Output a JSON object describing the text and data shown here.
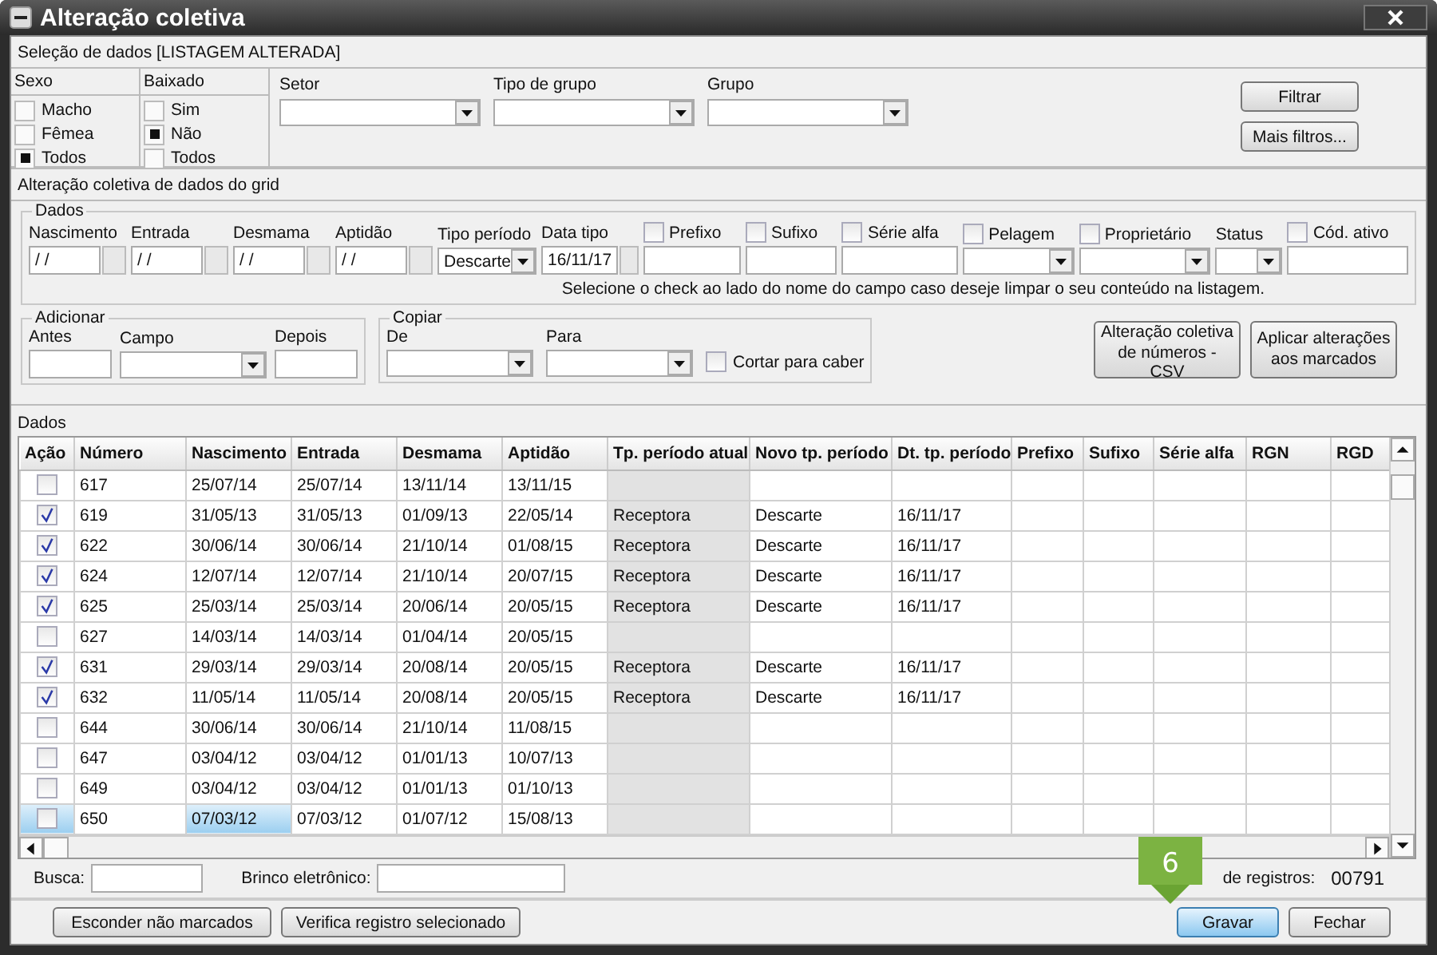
{
  "window": {
    "title": "Alteração coletiva"
  },
  "selection": {
    "title": "Seleção de dados [LISTAGEM ALTERADA]",
    "groups": [
      {
        "label": "Sexo",
        "options": [
          {
            "label": "Macho",
            "selected": false
          },
          {
            "label": "Fêmea",
            "selected": false
          },
          {
            "label": "Todos",
            "selected": true
          }
        ]
      },
      {
        "label": "Baixado",
        "options": [
          {
            "label": "Sim",
            "selected": false
          },
          {
            "label": "Não",
            "selected": true
          },
          {
            "label": "Todos",
            "selected": false
          }
        ]
      }
    ],
    "dropdowns": [
      {
        "label": "Setor"
      },
      {
        "label": "Tipo de grupo"
      },
      {
        "label": "Grupo"
      }
    ],
    "buttons": [
      "Filtrar",
      "Mais filtros..."
    ]
  },
  "bulk_edit": {
    "title": "Alteração coletiva de dados do grid",
    "dados": {
      "legend": "Dados",
      "fields": [
        {
          "kind": "date",
          "label": "Nascimento",
          "value": "/ /"
        },
        {
          "kind": "date",
          "label": "Entrada",
          "value": "/ /"
        },
        {
          "kind": "date",
          "label": "Desmama",
          "value": "/ /"
        },
        {
          "kind": "date",
          "label": "Aptidão",
          "value": "/ /"
        },
        {
          "kind": "select",
          "label": "Tipo período",
          "value": "Descarte"
        },
        {
          "kind": "date",
          "label": "Data tipo",
          "value": "16/11/17"
        },
        {
          "kind": "text",
          "label": "Prefixo",
          "checked": false
        },
        {
          "kind": "text",
          "label": "Sufixo",
          "checked": false
        },
        {
          "kind": "text",
          "label": "Série alfa",
          "checked": false
        },
        {
          "kind": "select",
          "label": "Pelagem",
          "checked": false
        },
        {
          "kind": "select",
          "label": "Proprietário",
          "checked": false
        },
        {
          "kind": "select",
          "label": "Status"
        },
        {
          "kind": "text",
          "label": "Cód. ativo",
          "checked": false
        }
      ],
      "hint": "Selecione o check ao lado do nome do campo caso deseje limpar o seu conteúdo na listagem."
    },
    "adicionar": {
      "legend": "Adicionar",
      "fields": [
        {
          "kind": "text",
          "label": "Antes"
        },
        {
          "kind": "select",
          "label": "Campo"
        },
        {
          "kind": "text",
          "label": "Depois"
        }
      ]
    },
    "copiar": {
      "legend": "Copiar",
      "fields": [
        {
          "kind": "select",
          "label": "De"
        },
        {
          "kind": "select",
          "label": "Para"
        }
      ],
      "option": {
        "label": "Cortar para caber",
        "checked": false
      }
    },
    "buttons": [
      "Alteração coletiva de números - CSV",
      "Aplicar alterações aos marcados"
    ]
  },
  "grid": {
    "title": "Dados",
    "columns": [
      {
        "label": "Ação",
        "shaded": false
      },
      {
        "label": "Número",
        "shaded": false
      },
      {
        "label": "Nascimento",
        "shaded": false
      },
      {
        "label": "Entrada",
        "shaded": false
      },
      {
        "label": "Desmama",
        "shaded": false
      },
      {
        "label": "Aptidão",
        "shaded": false
      },
      {
        "label": "Tp. período atual",
        "shaded": true
      },
      {
        "label": "Novo tp. período",
        "shaded": false
      },
      {
        "label": "Dt. tp. período",
        "shaded": false
      },
      {
        "label": "Prefixo",
        "shaded": false
      },
      {
        "label": "Sufixo",
        "shaded": false
      },
      {
        "label": "Série alfa",
        "shaded": false
      },
      {
        "label": "RGN",
        "shaded": false
      },
      {
        "label": "RGD",
        "shaded": false
      }
    ],
    "rows": [
      {
        "checked": false,
        "selected": false,
        "number": "617",
        "birth": "25/07/14",
        "entry": "25/07/14",
        "weaning": "13/11/14",
        "aptitude": "13/11/15"
      },
      {
        "checked": true,
        "selected": false,
        "number": "619",
        "birth": "31/05/13",
        "entry": "31/05/13",
        "weaning": "01/09/13",
        "aptitude": "22/05/14",
        "current_period": "Receptora",
        "new_period": "Descarte",
        "period_date": "16/11/17"
      },
      {
        "checked": true,
        "selected": false,
        "number": "622",
        "birth": "30/06/14",
        "entry": "30/06/14",
        "weaning": "21/10/14",
        "aptitude": "01/08/15",
        "current_period": "Receptora",
        "new_period": "Descarte",
        "period_date": "16/11/17"
      },
      {
        "checked": true,
        "selected": false,
        "number": "624",
        "birth": "12/07/14",
        "entry": "12/07/14",
        "weaning": "21/10/14",
        "aptitude": "20/07/15",
        "current_period": "Receptora",
        "new_period": "Descarte",
        "period_date": "16/11/17"
      },
      {
        "checked": true,
        "selected": false,
        "number": "625",
        "birth": "25/03/14",
        "entry": "25/03/14",
        "weaning": "20/06/14",
        "aptitude": "20/05/15",
        "current_period": "Receptora",
        "new_period": "Descarte",
        "period_date": "16/11/17"
      },
      {
        "checked": false,
        "selected": false,
        "number": "627",
        "birth": "14/03/14",
        "entry": "14/03/14",
        "weaning": "01/04/14",
        "aptitude": "20/05/15"
      },
      {
        "checked": true,
        "selected": false,
        "number": "631",
        "birth": "29/03/14",
        "entry": "29/03/14",
        "weaning": "20/08/14",
        "aptitude": "20/05/15",
        "current_period": "Receptora",
        "new_period": "Descarte",
        "period_date": "16/11/17"
      },
      {
        "checked": true,
        "selected": false,
        "number": "632",
        "birth": "11/05/14",
        "entry": "11/05/14",
        "weaning": "20/08/14",
        "aptitude": "20/05/15",
        "current_period": "Receptora",
        "new_period": "Descarte",
        "period_date": "16/11/17"
      },
      {
        "checked": false,
        "selected": false,
        "number": "644",
        "birth": "30/06/14",
        "entry": "30/06/14",
        "weaning": "21/10/14",
        "aptitude": "11/08/15"
      },
      {
        "checked": false,
        "selected": false,
        "number": "647",
        "birth": "03/04/12",
        "entry": "03/04/12",
        "weaning": "01/01/13",
        "aptitude": "10/07/13"
      },
      {
        "checked": false,
        "selected": false,
        "number": "649",
        "birth": "03/04/12",
        "entry": "03/04/12",
        "weaning": "01/01/13",
        "aptitude": "01/10/13"
      },
      {
        "checked": false,
        "selected": true,
        "number": "650",
        "birth": "07/03/12",
        "entry": "07/03/12",
        "weaning": "01/07/12",
        "aptitude": "15/08/13"
      }
    ]
  },
  "search": {
    "fields": [
      {
        "label": "Busca:"
      },
      {
        "label": "Brinco eletrônico:"
      }
    ],
    "total_label": "de registros:",
    "total": "00791"
  },
  "callout": {
    "number": "6"
  },
  "buttons": [
    {
      "label": "Esconder não marcados",
      "focused": false
    },
    {
      "label": "Verifica registro selecionado",
      "focused": false
    },
    {
      "label": "Gravar",
      "focused": true
    },
    {
      "label": "Fechar",
      "focused": false
    }
  ]
}
